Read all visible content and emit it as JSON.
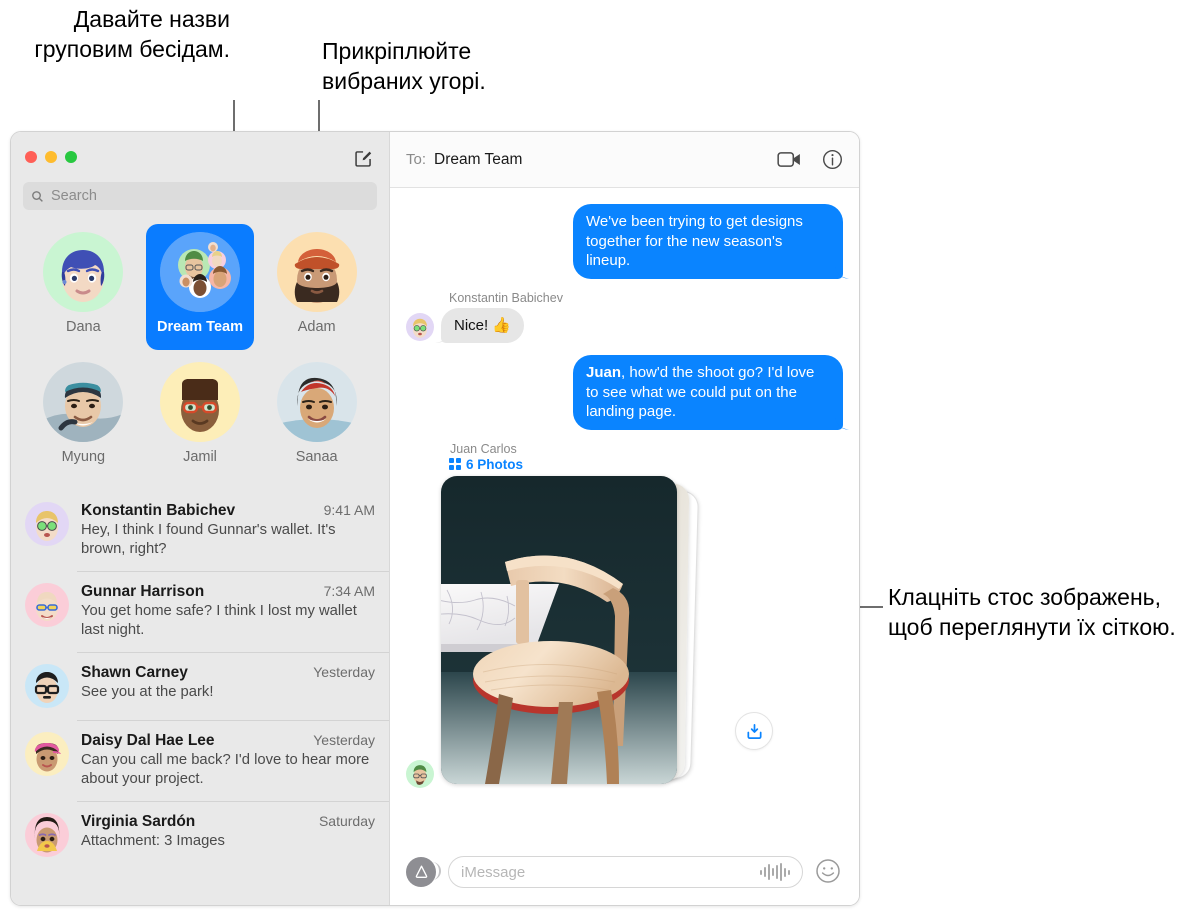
{
  "callouts": {
    "left": "Давайте назви груповим бесідам.",
    "middle": "Прикріплюйте вибраних угорі.",
    "right": "Клацніть стос зображень, щоб переглянути їх сіткою."
  },
  "window": {
    "traffic_lights": [
      "close",
      "minimize",
      "maximize"
    ],
    "compose_icon": "compose-icon"
  },
  "sidebar": {
    "search": {
      "placeholder": "Search",
      "icon": "search-icon"
    },
    "pinned": [
      {
        "name": "Dana",
        "selected": false,
        "avatar_bg": "#c9f5d2"
      },
      {
        "name": "Dream Team",
        "selected": true,
        "avatar_bg": "#5aa4fb"
      },
      {
        "name": "Adam",
        "selected": false,
        "avatar_bg": "#fcdfb0"
      },
      {
        "name": "Myung",
        "selected": false,
        "avatar_bg": "#f2f2f2"
      },
      {
        "name": "Jamil",
        "selected": false,
        "avatar_bg": "#fdeeb8"
      },
      {
        "name": "Sanaa",
        "selected": false,
        "avatar_bg": "#e8eef2"
      }
    ],
    "conversations": [
      {
        "name": "Konstantin Babichev",
        "time": "9:41 AM",
        "snippet": "Hey, I think I found Gunnar's wallet. It's brown, right?",
        "avatar_bg": "#e2d7f5"
      },
      {
        "name": "Gunnar Harrison",
        "time": "7:34 AM",
        "snippet": "You get home safe? I think I lost my wallet last night.",
        "avatar_bg": "#fbcdd8"
      },
      {
        "name": "Shawn Carney",
        "time": "Yesterday",
        "snippet": "See you at the park!",
        "avatar_bg": "#c9e7f7"
      },
      {
        "name": "Daisy Dal Hae Lee",
        "time": "Yesterday",
        "snippet": "Can you call me back? I'd love to hear more about your project.",
        "avatar_bg": "#fbeec0"
      },
      {
        "name": "Virginia Sardón",
        "time": "Saturday",
        "snippet": "Attachment: 3 Images",
        "avatar_bg": "#fbcdd8"
      }
    ]
  },
  "conversation": {
    "to_label": "To:",
    "to_value": "Dream Team",
    "header_actions": [
      {
        "icon": "facetime-video-icon"
      },
      {
        "icon": "info-icon"
      }
    ],
    "messages": [
      {
        "kind": "text",
        "direction": "out",
        "text": "We've been trying to get designs together for the new season's lineup."
      },
      {
        "kind": "text",
        "direction": "in",
        "sender": "Konstantin Babichev",
        "text": "Nice!  👍",
        "avatar_bg": "#e2d7f5"
      },
      {
        "kind": "text",
        "direction": "out",
        "bold_prefix": "Juan",
        "text": ", how'd the shoot go? I'd love to see what we could put on the landing page."
      },
      {
        "kind": "photo-stack",
        "direction": "in",
        "sender": "Juan Carlos",
        "count_label": "6 Photos",
        "count_icon": "grid-icon",
        "avatar_bg": "#c9f5d2",
        "download_icon": "download-icon"
      }
    ],
    "composer": {
      "appstore_icon": "app-store-icon",
      "placeholder": "iMessage",
      "audio_icon": "audio-waveform-icon",
      "emoji_icon": "emoji-smiley-icon"
    }
  },
  "colors": {
    "accent_blue": "#0a84ff",
    "selected_pin": "#0a7cff",
    "incoming_bubble": "#e6e6e6",
    "sidebar_bg": "#e9e9e9"
  }
}
